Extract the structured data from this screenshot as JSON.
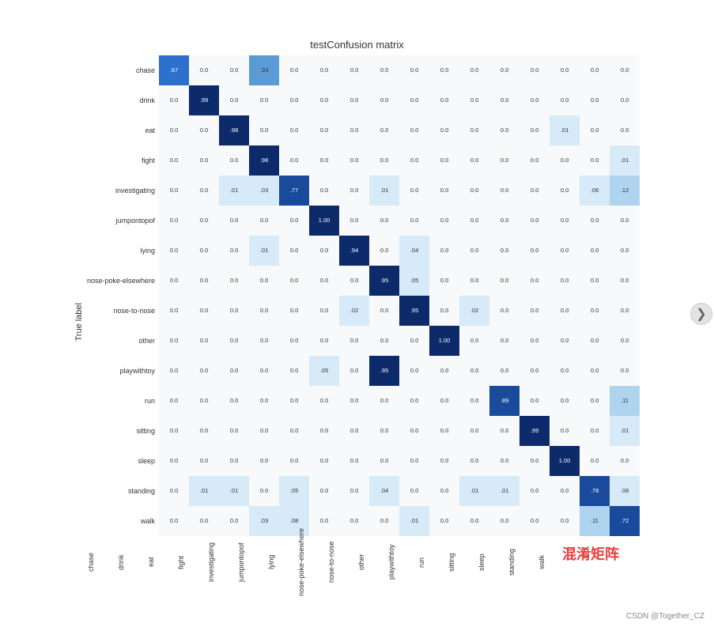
{
  "title": "testConfusion matrix",
  "yAxisLabel": "True label",
  "footerText": "CSDN @Together_CZ",
  "watermark": "混淆矩阵",
  "navArrow": "❯",
  "labels": [
    "chase",
    "drink",
    "eat",
    "fight",
    "investigating",
    "jumpontopof",
    "lying",
    "nose-poke-elsewhere",
    "nose-to-nose",
    "other",
    "playwithtoy",
    "run",
    "sitting",
    "sleep",
    "standing",
    "walk"
  ],
  "xLabels": [
    "chase",
    "drink",
    "eat",
    "fight",
    "investigating",
    "jumpontopof",
    "lying",
    "nose-poke-elsewhere",
    "nose-to-nose",
    "other",
    "playwithtoy",
    "run",
    "sitting",
    "sleep",
    "standing",
    "walk"
  ],
  "matrix": [
    [
      0.67,
      0.0,
      0.0,
      0.33,
      0.0,
      0.0,
      0.0,
      0.0,
      0.0,
      0.0,
      0.0,
      0.0,
      0.0,
      0.0,
      0.0,
      0.0
    ],
    [
      0.0,
      0.99,
      0.0,
      0.0,
      0.0,
      0.0,
      0.0,
      0.0,
      0.0,
      0.0,
      0.0,
      0.0,
      0.0,
      0.0,
      0.0,
      0.0
    ],
    [
      0.0,
      0.0,
      0.98,
      0.0,
      0.0,
      0.0,
      0.0,
      0.0,
      0.0,
      0.0,
      0.0,
      0.0,
      0.0,
      0.01,
      0.0,
      0.0
    ],
    [
      0.0,
      0.0,
      0.0,
      0.98,
      0.0,
      0.0,
      0.0,
      0.0,
      0.0,
      0.0,
      0.0,
      0.0,
      0.0,
      0.0,
      0.0,
      0.01
    ],
    [
      0.0,
      0.0,
      0.01,
      0.03,
      0.77,
      0.0,
      0.0,
      0.01,
      0.0,
      0.0,
      0.0,
      0.0,
      0.0,
      0.0,
      0.06,
      0.12
    ],
    [
      0.0,
      0.0,
      0.0,
      0.0,
      0.0,
      1.0,
      0.0,
      0.0,
      0.0,
      0.0,
      0.0,
      0.0,
      0.0,
      0.0,
      0.0,
      0.0
    ],
    [
      0.0,
      0.0,
      0.0,
      0.01,
      0.0,
      0.0,
      0.94,
      0.0,
      0.04,
      0.0,
      0.0,
      0.0,
      0.0,
      0.0,
      0.0,
      0.0
    ],
    [
      0.0,
      0.0,
      0.0,
      0.0,
      0.0,
      0.0,
      0.0,
      0.95,
      0.05,
      0.0,
      0.0,
      0.0,
      0.0,
      0.0,
      0.0,
      0.0
    ],
    [
      0.0,
      0.0,
      0.0,
      0.0,
      0.0,
      0.0,
      0.02,
      0.0,
      0.95,
      0.0,
      0.02,
      0.0,
      0.0,
      0.0,
      0.0,
      0.0
    ],
    [
      0.0,
      0.0,
      0.0,
      0.0,
      0.0,
      0.0,
      0.0,
      0.0,
      0.0,
      1.0,
      0.0,
      0.0,
      0.0,
      0.0,
      0.0,
      0.0
    ],
    [
      0.0,
      0.0,
      0.0,
      0.0,
      0.0,
      0.05,
      0.0,
      0.95,
      0.0,
      0.0,
      0.0,
      0.0,
      0.0,
      0.0,
      0.0,
      0.0
    ],
    [
      0.0,
      0.0,
      0.0,
      0.0,
      0.0,
      0.0,
      0.0,
      0.0,
      0.0,
      0.0,
      0.0,
      0.89,
      0.0,
      0.0,
      0.0,
      0.11
    ],
    [
      0.0,
      0.0,
      0.0,
      0.0,
      0.0,
      0.0,
      0.0,
      0.0,
      0.0,
      0.0,
      0.0,
      0.0,
      0.99,
      0.0,
      0.0,
      0.01
    ],
    [
      0.0,
      0.0,
      0.0,
      0.0,
      0.0,
      0.0,
      0.0,
      0.0,
      0.0,
      0.0,
      0.0,
      0.0,
      0.0,
      1.0,
      0.0,
      0.0
    ],
    [
      0.0,
      0.01,
      0.01,
      0.0,
      0.05,
      0.0,
      0.0,
      0.04,
      0.0,
      0.0,
      0.01,
      0.01,
      0.0,
      0.0,
      0.78,
      0.08
    ],
    [
      0.0,
      0.0,
      0.0,
      0.03,
      0.08,
      0.0,
      0.0,
      0.0,
      0.01,
      0.0,
      0.0,
      0.0,
      0.0,
      0.0,
      0.11,
      0.72
    ]
  ]
}
